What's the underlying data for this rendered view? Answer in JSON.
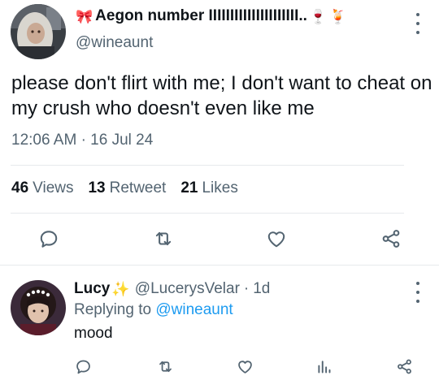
{
  "tweet": {
    "author": {
      "name": "Aegon number IIIIIIIIIIIIIIIIIIIII..",
      "name_prefix_emoji": "🎀",
      "name_suffix_emojis": [
        "🍷",
        "🍹"
      ],
      "handle": "@wineaunt",
      "avatar": "avatar-man-silver-hair"
    },
    "text": "please don't flirt with me; I don't want to cheat on my crush who doesn't even like me",
    "time": "12:06 AM",
    "separator": "·",
    "date": "16 Jul 24",
    "stats": {
      "views_count": "46",
      "views_label": "Views",
      "retweets_count": "13",
      "retweets_label": "Retweet",
      "likes_count": "21",
      "likes_label": "Likes"
    },
    "actions": [
      "reply-icon",
      "retweet-icon",
      "like-icon",
      "share-icon"
    ]
  },
  "reply": {
    "name": "Lucy",
    "badge_emoji": "✨",
    "handle": "@LucerysVelar",
    "separator": "·",
    "time_ago": "1d",
    "replying_to_label": "Replying to",
    "replying_to_handle": "@wineaunt",
    "text": "mood",
    "avatar": "avatar-boy-flower-crown",
    "actions": [
      "reply-icon",
      "retweet-icon",
      "like-icon",
      "views-icon",
      "share-icon"
    ]
  },
  "colors": {
    "text_primary": "#0f1419",
    "text_secondary": "#536471",
    "link": "#1d9bf0",
    "divider": "#e6e9ec",
    "icon": "#536471"
  }
}
